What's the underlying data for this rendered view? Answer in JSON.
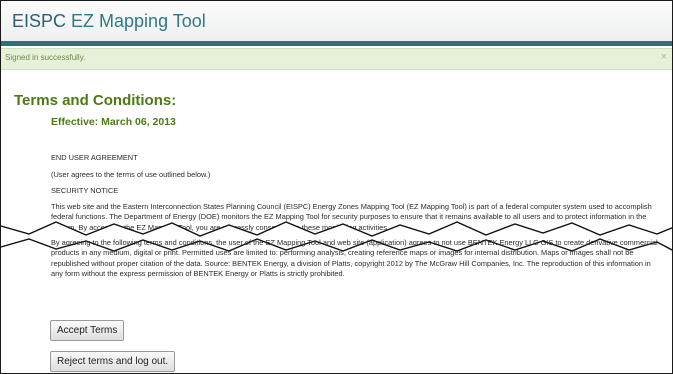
{
  "app": {
    "title_part1": "EISPC ",
    "title_part2": "EZ Mapping Tool"
  },
  "notice": {
    "text": "Signed in successfully.",
    "close_glyph": "×"
  },
  "terms": {
    "title": "Terms and Conditions:",
    "effective": "Effective: March 06, 2013",
    "heading_agreement": "END USER AGREEMENT",
    "subheading": "(User agrees to the terms of use outlined below.)",
    "heading_security": "SECURITY NOTICE",
    "security_paragraph": "This web site and the Eastern Interconnection States Planning Council (EISPC) Energy Zones Mapping Tool (EZ Mapping Tool) is part of a federal computer system used to accomplish federal functions. The Department of Energy (DOE) monitors the EZ Mapping Tool for security purposes to ensure that it remains available to all users and to protect information in the system. By accessing the EZ Mapping Tool, you are expressly consenting to these monitoring activities.",
    "usage_paragraph": "By agreeing to the following terms and conditions, the user of the EZ Mapping Tool and web site (application) agrees to not use BENTEK Energy LLC GIS to create derivative commercial products in any medium, digital or print. Permitted uses are limited to: performing analysis, creating reference maps or images for internal distribution. Maps or images shall not be republished without proper citation of the data. Source: BENTEK Energy, a division of Platts, copyright 2012 by The McGraw Hill Companies, Inc. The reproduction of this information in any form without the express permission of BENTEK Energy or Platts is strictly prohibited."
  },
  "buttons": {
    "accept": "Accept Terms",
    "reject": "Reject terms and log out."
  },
  "colors": {
    "title_blue": "#2b5f76",
    "header_bar": "#2e6f7a",
    "green_heading": "#4c7a13",
    "notice_bg": "#e7f1da",
    "notice_text": "#6c8a47"
  }
}
